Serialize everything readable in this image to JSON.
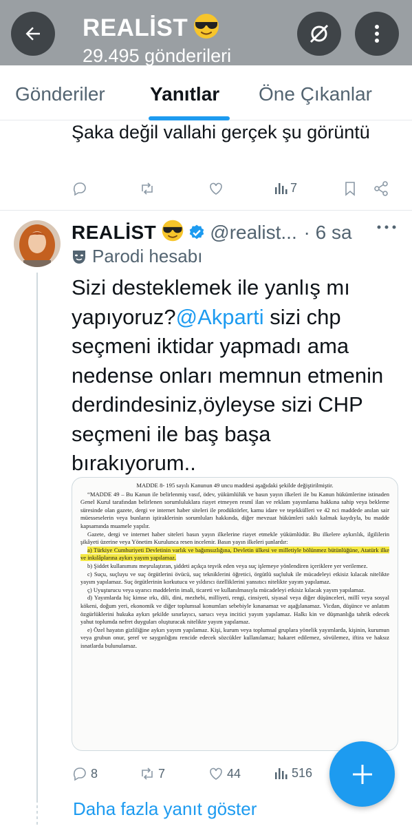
{
  "header": {
    "title": "REALİST",
    "subtitle": "29.495 gönderileri"
  },
  "tabs": [
    {
      "label": "Gönderiler"
    },
    {
      "label": "Yanıtlar"
    },
    {
      "label": "Öne Çıkanlar"
    }
  ],
  "previous_reply": {
    "text": "Şaka değil vallahi gerçek şu görüntü",
    "views": "7"
  },
  "tweet": {
    "name": "REALİST",
    "handle": "@realist...",
    "time": "· 6 sa",
    "parody_label": "Parodi hesabı",
    "text_before": "Sizi desteklemek ile yanlış mı yapıyoruz?",
    "mention": "@Akparti",
    "text_after": " sizi chp seçmeni iktidar yapmadı ama nedense onları memnun etmenin derdindesiniz,öyleyse sizi CHP seçmeni ile baş başa bırakıyorum..",
    "replies": "8",
    "reposts": "7",
    "likes": "44",
    "views": "516"
  },
  "document": {
    "p1": "MADDE 8- 195 sayılı Kanunun 49 uncu maddesi aşağıdaki şekilde değiştirilmiştir.",
    "p2": "“MADDE 49 – Bu Kanun ile belirlenmiş vasıf, ödev, yükümlülük ve basın yayın ilkeleri ile bu Kanun hükümlerine istinaden Genel Kurul tarafından belirlenen sorumluluklara riayet etmeyen resmî ilan ve reklam yayımlama hakkına sahip veya bekleme süresinde olan gazete, dergi ve internet haber siteleri ile prodüktörler, kamu idare ve teşekkülleri ve 42 nci maddede anılan sair müesseselerin veya bunların iştiraklerinin sorumluları hakkında, diğer mevzuat hükümleri saklı kalmak kaydıyla, bu madde kapsamında muamele yapılır.",
    "p3": "Gazete, dergi ve internet haber siteleri basın yayın ilkelerine riayet etmekle yükümlüdür. Bu ilkelere aykırılık, ilgililerin şikâyeti üzerine veya Yönetim Kurulunca resen incelenir. Basın yayın ilkeleri şunlardır:",
    "pa": "a) Türkiye Cumhuriyeti Devletinin varlık ve bağımsızlığına, Devletin ülkesi ve milletiyle bölünmez bütünlüğüne, Atatürk ilke ve inkılâplarına aykırı yayım yapılamaz.",
    "pb": "b) Şiddet kullanımını meşrulaştıran, şiddeti açıkça teşvik eden veya suç işlemeye yönlendiren içeriklere yer verilemez.",
    "pc": "c) Suçu, suçluyu ve suç örgütlerini övücü, suç tekniklerini öğretici, örgütlü suçluluk ile mücadeleyi etkisiz kılacak nitelikte yayım yapılamaz. Suç örgütlerinin korkutucu ve yıldırıcı özelliklerini yansıtıcı nitelikte yayım yapılamaz.",
    "pd": "ç) Uyuşturucu veya uyarıcı maddelerin imali, ticareti ve kullanılmasıyla mücadeleyi etkisiz kılacak yayım yapılamaz.",
    "pe": "d) Yayımlarda hiç kimse ırkı, dili, dini, mezhebi, milliyeti, rengi, cinsiyeti, siyasal veya diğer düşünceleri, millî veya sosyal kökeni, doğum yeri, ekonomik ve diğer toplumsal konumları sebebiyle kınanamaz ve aşağılanamaz. Vicdan, düşünce ve anlatım özgürlüklerini hukuka aykırı şekilde sınırlayıcı, sarsıcı veya incitici yayım yapılamaz. Halkı kin ve düşmanlığa tahrik edecek yahut toplumda nefret duyguları oluşturacak nitelikte yayım yapılamaz.",
    "pf": "e) Özel hayatın gizliliğine aykırı yayım yapılamaz. Kişi, kurum veya toplumsal gruplara yönelik yayımlarda, kişinin, kurumun veya grubun onur, şeref ve saygınlığını rencide edecek sözcükler kullanılamaz; hakaret edilemez, sövülemez, iftira ve haksız isnatlarda bulunulamaz."
  },
  "show_more": "Daha fazla yanıt göster",
  "colors": {
    "accent": "#1d9bf0",
    "header_bg": "#9a9fa3",
    "muted_text": "#536471",
    "highlight": "#f4e842"
  },
  "icons": [
    "back-arrow-icon",
    "sunglasses-emoji-icon",
    "eye-slash-icon",
    "more-vertical-icon",
    "reply-icon",
    "repost-icon",
    "like-icon",
    "views-icon",
    "bookmark-icon",
    "share-icon",
    "verified-badge-icon",
    "parody-mask-icon",
    "more-horizontal-icon",
    "compose-plus-icon"
  ]
}
